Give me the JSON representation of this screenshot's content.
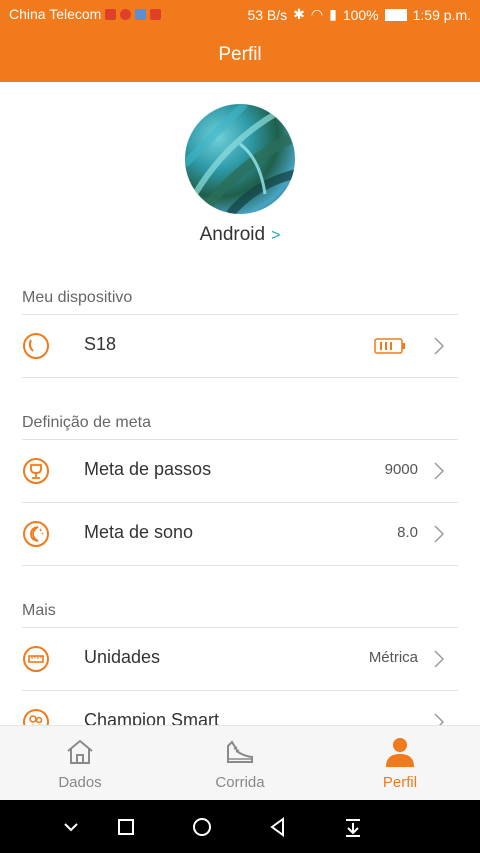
{
  "status_bar": {
    "carrier": "China Telecom",
    "speed": "53 B/s",
    "battery": "100%",
    "time": "1:59 p.m."
  },
  "app_bar": {
    "title": "Perfil"
  },
  "profile": {
    "username": "Android"
  },
  "sections": {
    "device": {
      "title": "Meu dispositivo",
      "device_name": "S18"
    },
    "goals": {
      "title": "Definição de meta",
      "steps_label": "Meta de passos",
      "steps_value": "9000",
      "sleep_label": "Meta de sono",
      "sleep_value": "8.0"
    },
    "more": {
      "title": "Mais",
      "units_label": "Unidades",
      "units_value": "Métrica",
      "champion_label": "Champion Smart"
    }
  },
  "bottom_nav": {
    "items": [
      {
        "label": "Dados",
        "icon": "home-icon"
      },
      {
        "label": "Corrida",
        "icon": "shoe-icon"
      },
      {
        "label": "Perfil",
        "icon": "person-icon"
      }
    ],
    "active_index": 2
  },
  "colors": {
    "accent": "#f07a1c",
    "teal": "#2aa3b5"
  }
}
